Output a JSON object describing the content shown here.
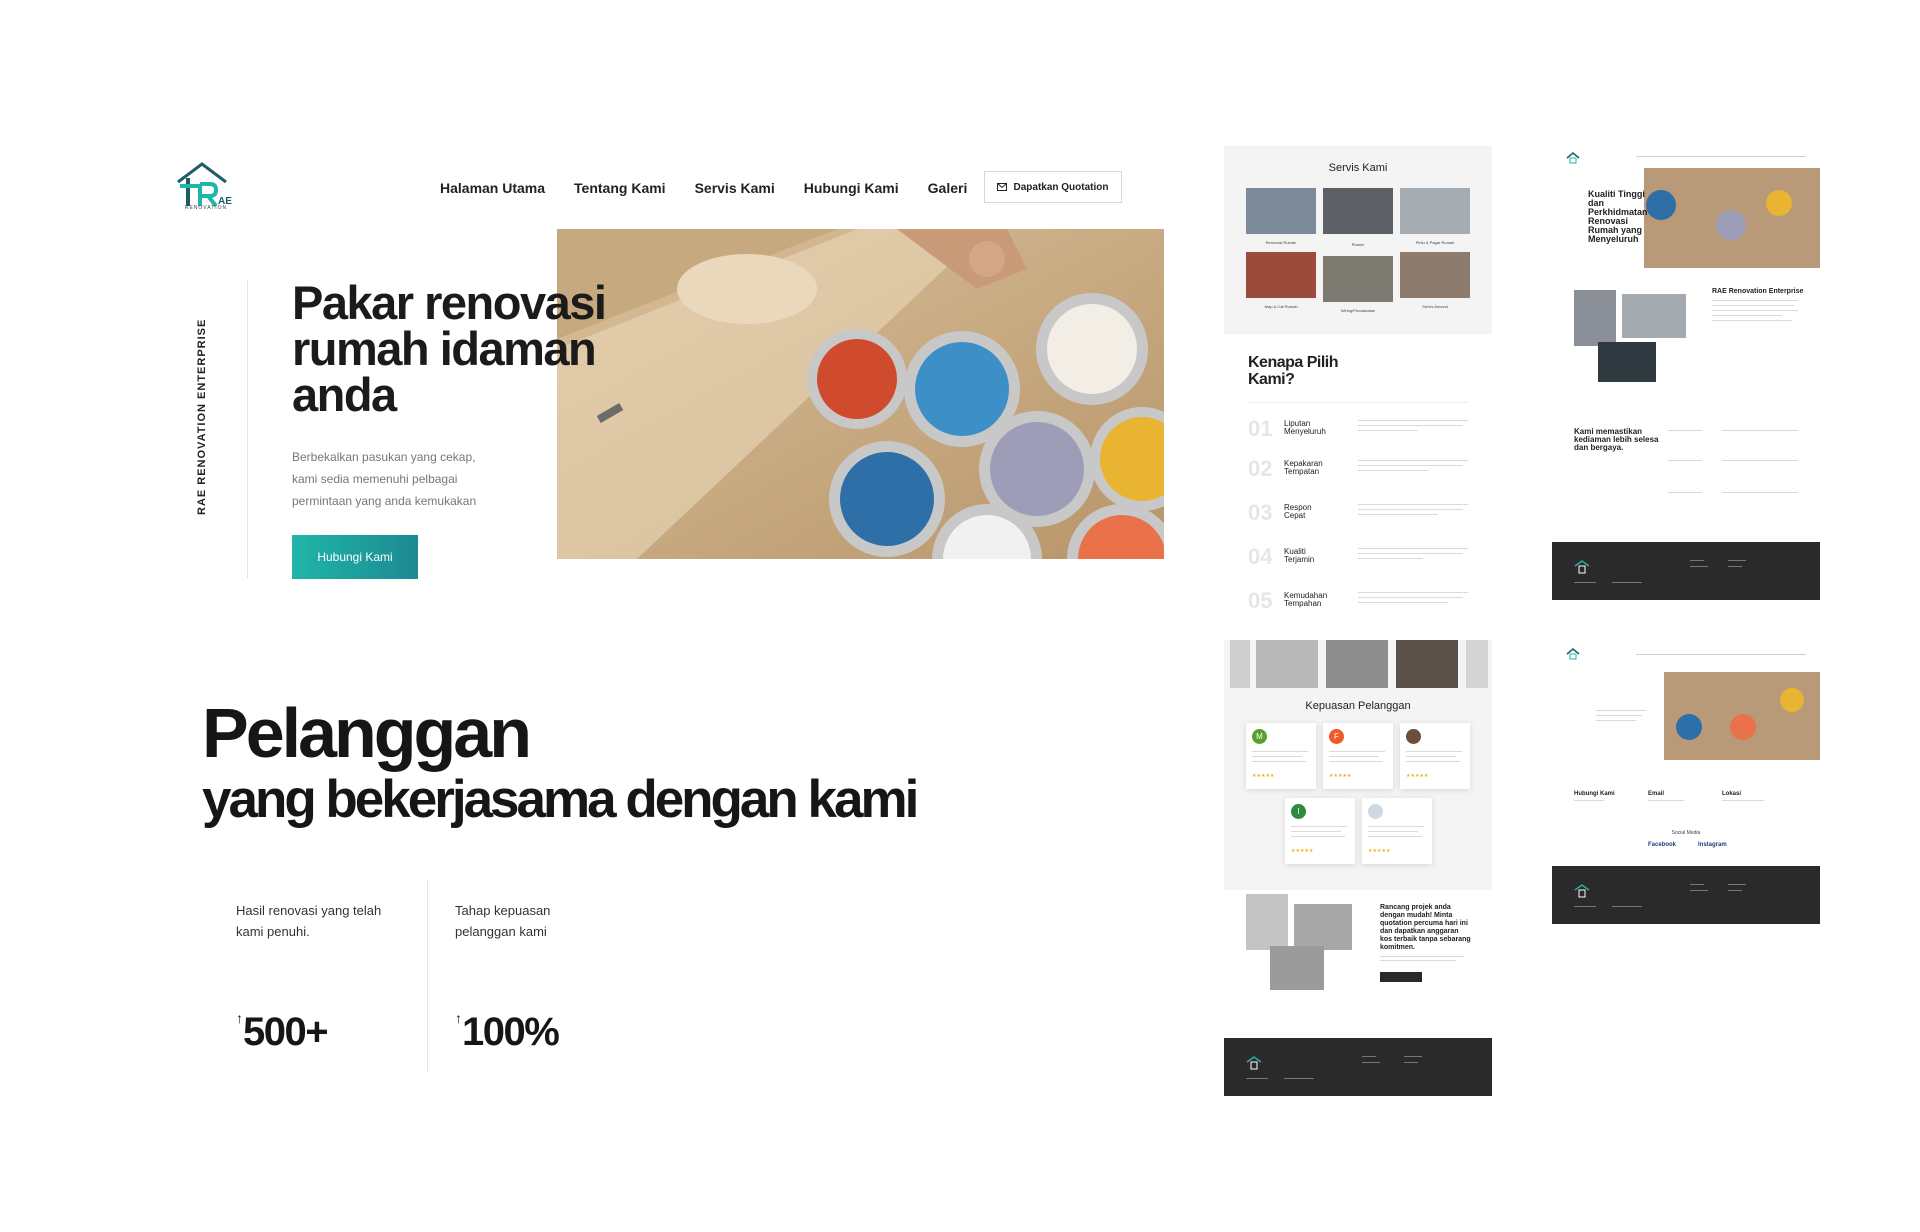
{
  "brand": {
    "logo_letters": "AE",
    "logo_sub": "RENOVATION",
    "vertical_label": "RAE RENOVATION ENTERPRISE"
  },
  "nav": {
    "items": [
      "Halaman Utama",
      "Tentang Kami",
      "Servis Kami",
      "Hubungi Kami",
      "Galeri"
    ],
    "quote_button": "Dapatkan Quotation"
  },
  "hero": {
    "title_line1": "Pakar renovasi",
    "title_line2": "rumah idaman",
    "title_line3": "anda",
    "description_line1": "Berbekalkan pasukan yang cekap,",
    "description_line2": "kami sedia memenuhi pelbagai",
    "description_line3": "permintaan yang anda kemukakan",
    "button": "Hubungi Kami"
  },
  "clients": {
    "title": "Pelanggan",
    "subtitle": "yang bekerjasama dengan kami",
    "stats": [
      {
        "label_line1": "Hasil renovasi yang telah",
        "label_line2": "kami penuhi.",
        "value": "500+",
        "arrow": "↑"
      },
      {
        "label_line1": "Tahap kepuasan",
        "label_line2": "pelanggan kami",
        "value": "100%",
        "arrow": "↑"
      }
    ]
  },
  "mini_services": {
    "title": "Servis Kami",
    "tiles": [
      "Renovasi Rumah",
      "Plaster",
      "Pintu & Pagar Rumah",
      "Atap & Cat Rumah",
      "Wiring/Pendawaian",
      "Servis Aircond"
    ]
  },
  "mini_why": {
    "title_line1": "Kenapa Pilih",
    "title_line2": "Kami?",
    "items": [
      {
        "num": "01",
        "label1": "Liputan",
        "label2": "Menyeluruh"
      },
      {
        "num": "02",
        "label1": "Kepakaran",
        "label2": "Tempatan"
      },
      {
        "num": "03",
        "label1": "Respon",
        "label2": "Cepat"
      },
      {
        "num": "04",
        "label1": "Kualiti",
        "label2": "Terjamin"
      },
      {
        "num": "05",
        "label1": "Kemudahan",
        "label2": "Tempahan"
      }
    ]
  },
  "mini_testimonials": {
    "title": "Kepuasan Pelanggan",
    "avatars": [
      "M",
      "F",
      "",
      "I",
      ""
    ],
    "avatar_colors": [
      "#5aa02c",
      "#f05a28",
      "#6b4f3a",
      "#2e8b3d",
      "#cfd8e3"
    ],
    "stars": "★★★★★"
  },
  "mini_cta": {
    "text": "Rancang projek anda dengan mudah! Minta quotation percuma hari ini dan dapatkan anggaran kos terbaik tanpa sebarang komitmen."
  },
  "mini_about": {
    "hero_text": "Kualiti Tinggi dan Perkhidmatan Renovasi Rumah yang Menyeluruh",
    "company": "RAE Renovation Enterprise",
    "promise": "Kami memastikan kediaman lebih selesa dan bergaya."
  },
  "mini_contact": {
    "labels": [
      "Hubungi Kami",
      "Email",
      "Lokasi"
    ],
    "social_title": "Social Media",
    "social": [
      "Facebook",
      "Instagram"
    ]
  },
  "colors": {
    "accent": "#1fb5a8",
    "accent_dark": "#1d8a93",
    "dark_footer": "#2a2a2a"
  }
}
